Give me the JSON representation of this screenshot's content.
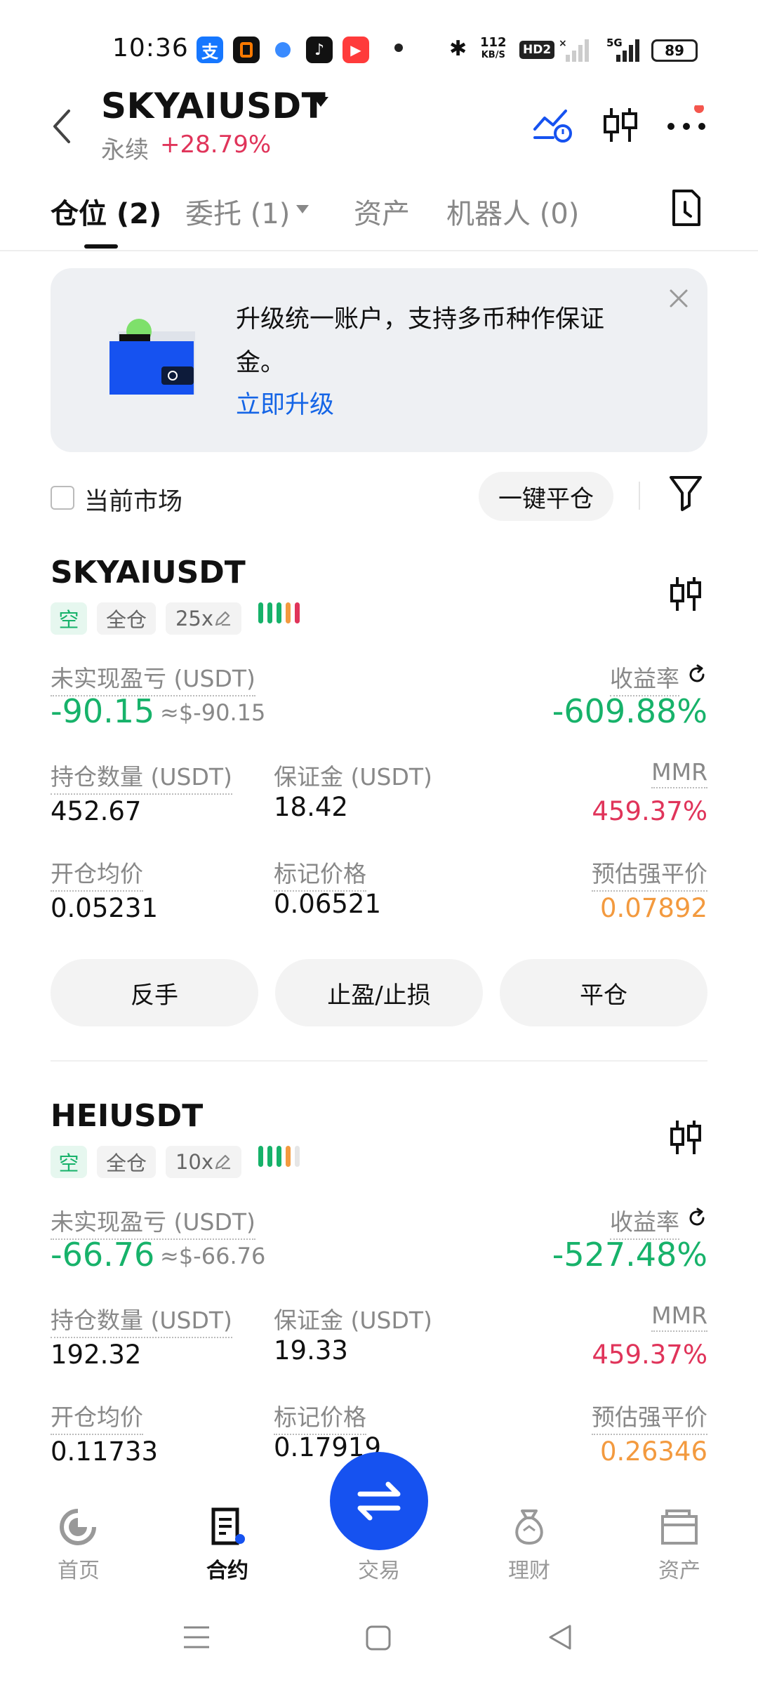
{
  "status_bar": {
    "time": "10:36",
    "net_speed_top": "112",
    "net_speed_unit": "KB/S",
    "hd": "HD2",
    "signal_5g": "5G",
    "battery": "89"
  },
  "header": {
    "symbol": "SKYAIUSDT",
    "contract_type": "永续",
    "change_pct": "+28.79%"
  },
  "tabs": [
    {
      "label": "仓位 (2)",
      "active": true
    },
    {
      "label": "委托 (1)",
      "active": false
    },
    {
      "label": "资产",
      "active": false
    },
    {
      "label": "机器人 (0)",
      "active": false
    }
  ],
  "banner": {
    "text": "升级统一账户，支持多币种作保证金。",
    "link": "立即升级"
  },
  "filter": {
    "current_market_label": "当前市场",
    "close_all_label": "一键平仓"
  },
  "labels": {
    "unrealized_pnl": "未实现盈亏 (USDT)",
    "roi": "收益率",
    "position_size": "持仓数量 (USDT)",
    "margin": "保证金 (USDT)",
    "mmr": "MMR",
    "entry_price": "开仓均价",
    "mark_price": "标记价格",
    "liq_price": "预估强平价"
  },
  "positions": [
    {
      "symbol": "SKYAIUSDT",
      "side": "空",
      "margin_mode": "全仓",
      "leverage": "25x",
      "pnl": "-90.15",
      "pnl_usd": "≈$-90.15",
      "roi": "-609.88%",
      "size": "452.67",
      "margin": "18.42",
      "mmr": "459.37%",
      "entry": "0.05231",
      "mark": "0.06521",
      "liq": "0.07892",
      "risk_bars": [
        "#17b26a",
        "#17b26a",
        "#17b26a",
        "#f39a3f",
        "#e0345a"
      ]
    },
    {
      "symbol": "HEIUSDT",
      "side": "空",
      "margin_mode": "全仓",
      "leverage": "10x",
      "pnl": "-66.76",
      "pnl_usd": "≈$-66.76",
      "roi": "-527.48%",
      "size": "192.32",
      "margin": "19.33",
      "mmr": "459.37%",
      "entry": "0.11733",
      "mark": "0.17919",
      "liq": "0.26346",
      "risk_bars": [
        "#17b26a",
        "#17b26a",
        "#17b26a",
        "#f39a3f",
        "#e6e6e6"
      ]
    }
  ],
  "actions": {
    "reverse": "反手",
    "tp_sl": "止盈/止损",
    "close": "平仓"
  },
  "bottom_nav": [
    {
      "label": "首页",
      "icon": "home-icon",
      "active": false
    },
    {
      "label": "合约",
      "icon": "contract-icon",
      "active": true
    },
    {
      "label": "交易",
      "icon": "trade-icon",
      "active": false
    },
    {
      "label": "理财",
      "icon": "earn-icon",
      "active": false
    },
    {
      "label": "资产",
      "icon": "wallet-icon",
      "active": false
    }
  ],
  "colors": {
    "green": "#17b26a",
    "red": "#e0345a",
    "orange": "#f39a3f",
    "blue": "#1652f0"
  }
}
